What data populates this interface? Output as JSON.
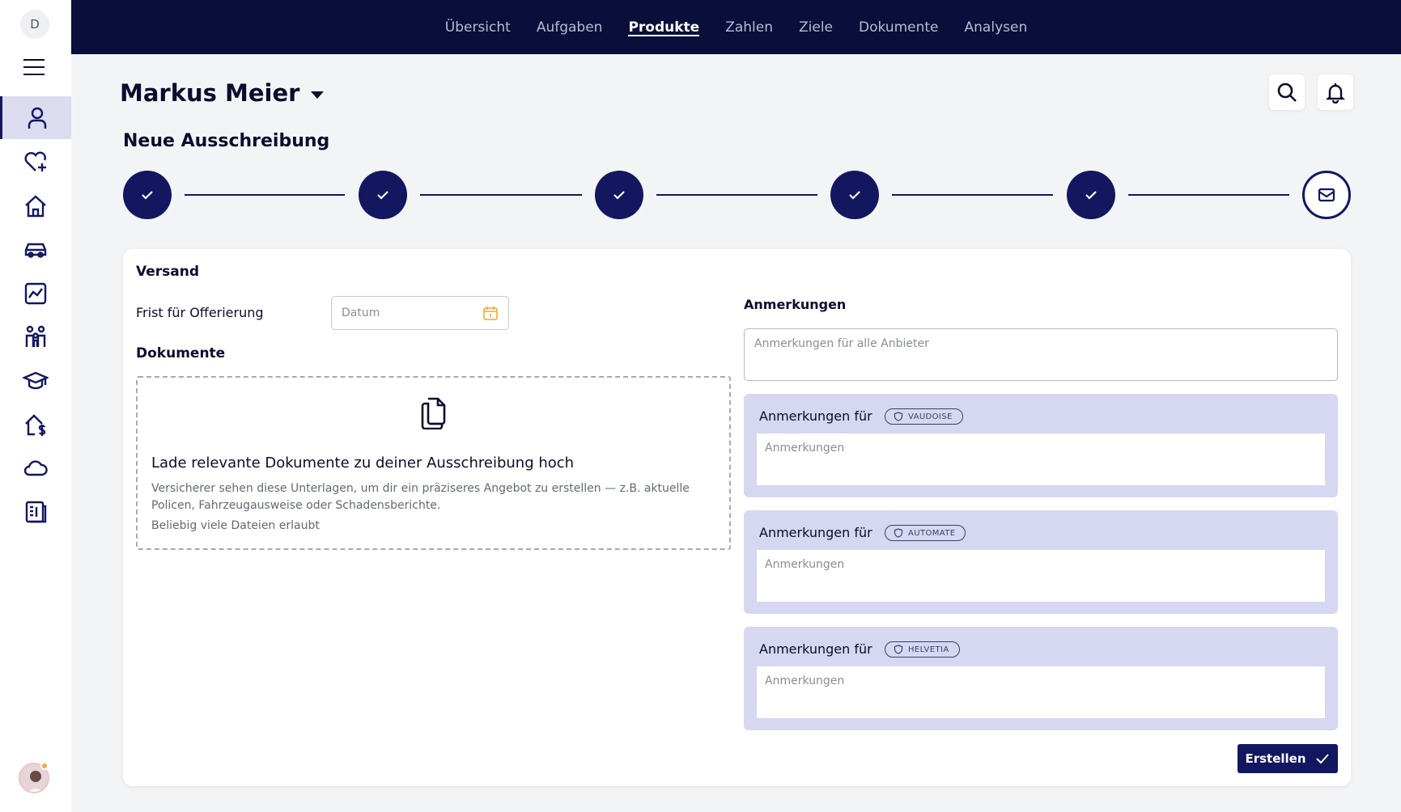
{
  "sidebar": {
    "logo_letter": "D",
    "items": [
      {
        "icon": "user-icon",
        "active": true
      },
      {
        "icon": "heart-plus-icon",
        "active": false
      },
      {
        "icon": "home-icon",
        "active": false
      },
      {
        "icon": "car-icon",
        "active": false
      },
      {
        "icon": "chart-icon",
        "active": false
      },
      {
        "icon": "family-icon",
        "active": false
      },
      {
        "icon": "graduation-cap-icon",
        "active": false
      },
      {
        "icon": "house-dollar-icon",
        "active": false
      },
      {
        "icon": "cloud-icon",
        "active": false
      },
      {
        "icon": "document-list-icon",
        "active": false
      }
    ]
  },
  "topnav": {
    "items": [
      "Übersicht",
      "Aufgaben",
      "Produkte",
      "Zahlen",
      "Ziele",
      "Dokumente",
      "Analysen"
    ],
    "active": "Produkte"
  },
  "header": {
    "user_name": "Markus Meier",
    "page_title": "Neue Ausschreibung"
  },
  "stepper": {
    "total_steps": 6,
    "completed_steps": 5
  },
  "form": {
    "section_title": "Versand",
    "deadline_label": "Frist für Offerierung",
    "date_placeholder": "Datum",
    "documents_title": "Dokumente",
    "dropzone": {
      "title": "Lade relevante Dokumente zu deiner Ausschreibung hoch",
      "description": "Versicherer sehen diese Unterlagen, um dir ein präziseres Angebot zu erstellen — z.B. aktuelle Policen, Fahrzeugausweise oder Schadensberichte.",
      "hint": "Beliebig viele Dateien erlaubt"
    },
    "remarks_title": "Anmerkungen",
    "remarks_all_placeholder": "Anmerkungen für alle Anbieter",
    "providers": [
      {
        "label": "Anmerkungen für",
        "name": "VAUDOISE",
        "placeholder": "Anmerkungen"
      },
      {
        "label": "Anmerkungen für",
        "name": "AUTOMATE",
        "placeholder": "Anmerkungen"
      },
      {
        "label": "Anmerkungen für",
        "name": "HELVETIA",
        "placeholder": "Anmerkungen"
      }
    ],
    "submit_label": "Erstellen"
  },
  "colors": {
    "primary": "#121760",
    "nav_bg": "#0a0e3a",
    "provider_bg": "#d6d7f1",
    "calendar_accent": "#f0a93a"
  }
}
